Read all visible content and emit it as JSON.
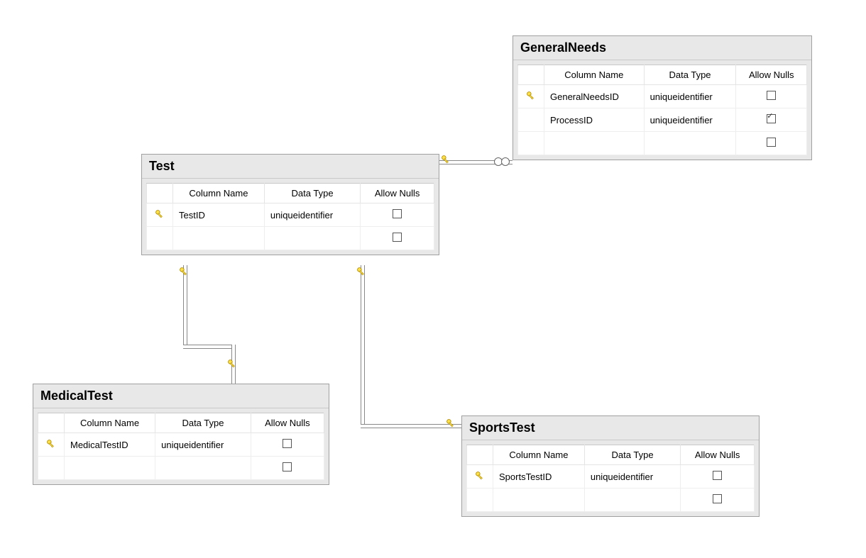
{
  "headers": {
    "colname": "Column Name",
    "datatype": "Data Type",
    "allownulls": "Allow Nulls"
  },
  "tables": {
    "general_needs": {
      "title": "GeneralNeeds",
      "rows": [
        {
          "pk": true,
          "name": "GeneralNeedsID",
          "type": "uniqueidentifier",
          "nullable": false
        },
        {
          "pk": false,
          "name": "ProcessID",
          "type": "uniqueidentifier",
          "nullable": true
        },
        {
          "pk": false,
          "name": "",
          "type": "",
          "nullable": false
        }
      ]
    },
    "test": {
      "title": "Test",
      "rows": [
        {
          "pk": true,
          "name": "TestID",
          "type": "uniqueidentifier",
          "nullable": false
        },
        {
          "pk": false,
          "name": "",
          "type": "",
          "nullable": false
        }
      ]
    },
    "medical_test": {
      "title": "MedicalTest",
      "rows": [
        {
          "pk": true,
          "name": "MedicalTestID",
          "type": "uniqueidentifier",
          "nullable": false
        },
        {
          "pk": false,
          "name": "",
          "type": "",
          "nullable": false
        }
      ]
    },
    "sports_test": {
      "title": "SportsTest",
      "rows": [
        {
          "pk": true,
          "name": "SportsTestID",
          "type": "uniqueidentifier",
          "nullable": false
        },
        {
          "pk": false,
          "name": "",
          "type": "",
          "nullable": false
        }
      ]
    }
  },
  "relations": [
    {
      "from": "Test",
      "to": "GeneralNeeds",
      "type": "one-to-many"
    },
    {
      "from": "Test",
      "to": "MedicalTest",
      "type": "one-to-many"
    },
    {
      "from": "Test",
      "to": "SportsTest",
      "type": "one-to-many"
    }
  ]
}
